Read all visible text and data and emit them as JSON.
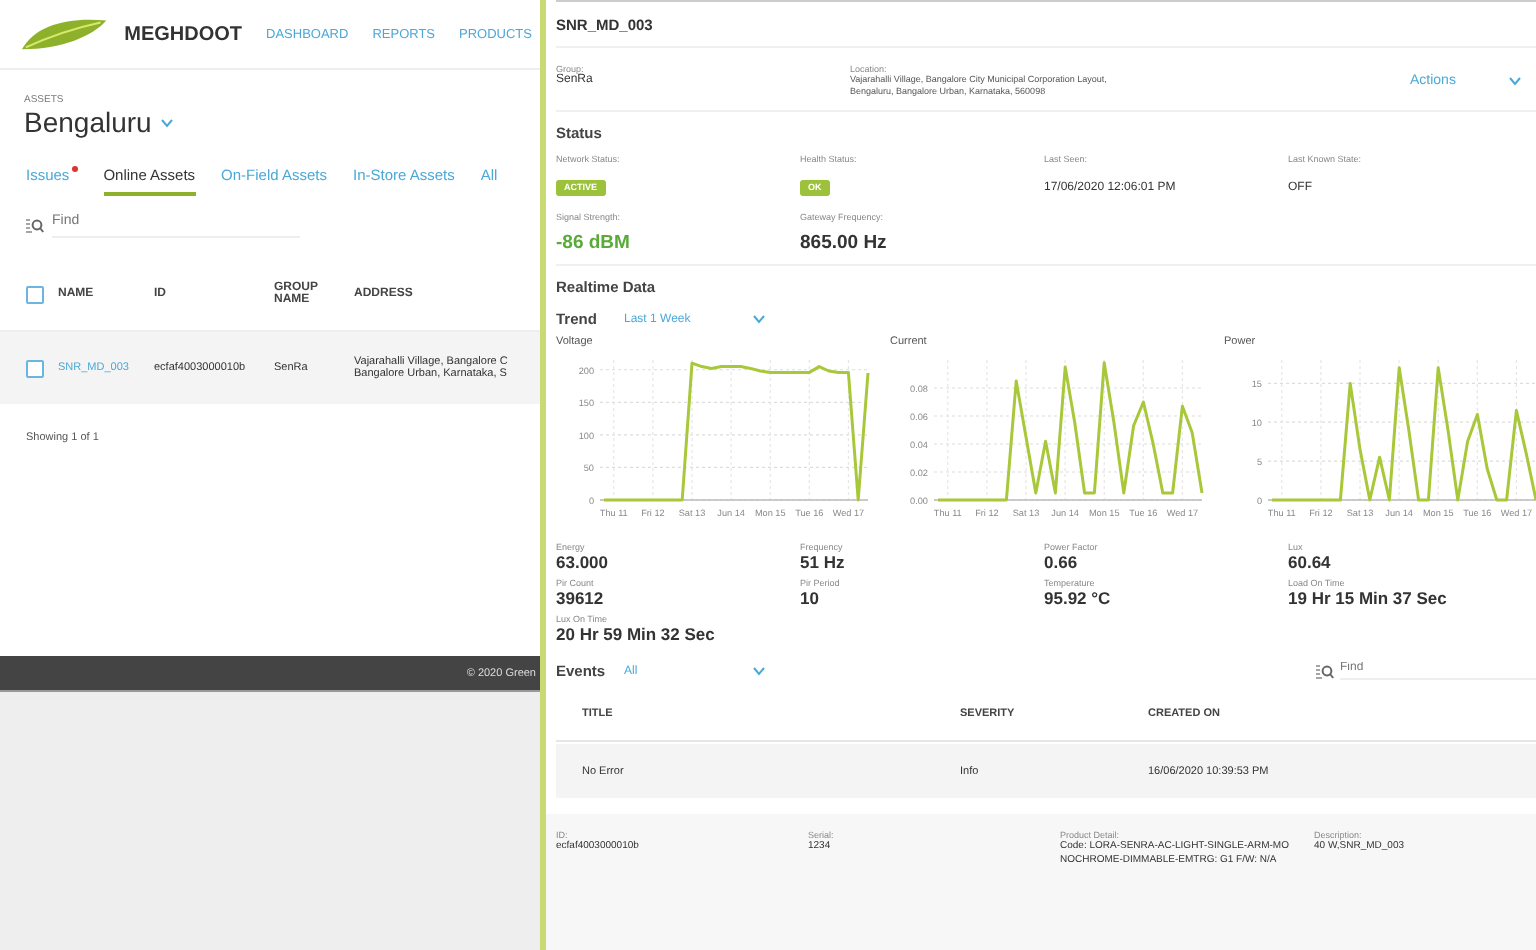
{
  "header": {
    "brand": "MEGHDOOT",
    "nav": [
      "DASHBOARD",
      "REPORTS",
      "PRODUCTS"
    ]
  },
  "assets": {
    "label": "ASSETS",
    "city": "Bengaluru"
  },
  "tabs": [
    {
      "label": "Issues",
      "selected": false,
      "alert": true
    },
    {
      "label": "Online Assets",
      "selected": true,
      "alert": false
    },
    {
      "label": "On-Field Assets",
      "selected": false,
      "alert": false
    },
    {
      "label": "In-Store Assets",
      "selected": false,
      "alert": false
    },
    {
      "label": "All",
      "selected": false,
      "alert": false
    }
  ],
  "search": {
    "placeholder": "Find"
  },
  "table": {
    "all_checked": false,
    "columns": [
      "NAME",
      "ID",
      "GROUP NAME",
      "ADDRESS"
    ],
    "rows": [
      {
        "checked": false,
        "name": "SNR_MD_003",
        "id": "ecfaf4003000010b",
        "group": "SenRa",
        "address": [
          "Vajarahalli Village, Bangalore C",
          "Bangalore Urban, Karnataka, S"
        ]
      }
    ]
  },
  "showing": "Showing 1 of 1",
  "footer": "© 2020 Green",
  "panel": {
    "title": "SNR_MD_003",
    "group_label": "Group:",
    "group": "SenRa",
    "location_label": "Location:",
    "location": [
      "Vajarahalli Village, Bangalore City Municipal Corporation Layout,",
      "Bengaluru, Bangalore Urban, Karnataka, 560098"
    ],
    "actions": "Actions"
  },
  "status": {
    "heading": "Status",
    "fields": [
      {
        "label": "Network Status:",
        "value": "ACTIVE",
        "kind": "badge"
      },
      {
        "label": "Health Status:",
        "value": "OK",
        "kind": "badge"
      },
      {
        "label": "Last Seen:",
        "value": "17/06/2020 12:06:01 PM",
        "kind": "text"
      },
      {
        "label": "Last Known State:",
        "value": "OFF",
        "kind": "text"
      },
      {
        "label": "Signal Strength:",
        "value": "-86 dBM",
        "kind": "good"
      },
      {
        "label": "Gateway Frequency:",
        "value": "865.00 Hz",
        "kind": "big"
      }
    ]
  },
  "realtime": {
    "heading": "Realtime Data",
    "trend_label": "Trend",
    "trend_value": "Last 1 Week",
    "charts": [
      {
        "chart_data": {
          "type": "line",
          "title": "Voltage",
          "grid": true,
          "ylim": [
            0,
            215
          ],
          "yticks": [
            0,
            50,
            100,
            150,
            200
          ],
          "categories": [
            null,
            "Thu 11",
            null,
            null,
            null,
            "Fri 12",
            null,
            null,
            null,
            "Sat 13",
            null,
            null,
            null,
            "Jun 14",
            null,
            null,
            null,
            "Mon 15",
            null,
            null,
            null,
            "Tue 16",
            null,
            null,
            null,
            "Wed 17",
            null,
            null
          ],
          "series": [
            {
              "color": "#a8c83a",
              "values": [
                0,
                0,
                0,
                0,
                0,
                0,
                0,
                0,
                0,
                210,
                205,
                202,
                205,
                205,
                205,
                202,
                198,
                196,
                196,
                196,
                196,
                196,
                205,
                198,
                196,
                196,
                0,
                195
              ]
            }
          ]
        }
      },
      {
        "chart_data": {
          "type": "line",
          "title": "Current",
          "grid": true,
          "ylim": [
            0,
            0.1
          ],
          "yticks": [
            {
              "value": 0,
              "label": "0.00"
            },
            {
              "value": 0.02,
              "label": "0.02"
            },
            {
              "value": 0.04,
              "label": "0.04"
            },
            {
              "value": 0.06,
              "label": "0.06"
            },
            {
              "value": 0.08,
              "label": "0.08"
            }
          ],
          "categories": [
            null,
            "Thu 11",
            null,
            null,
            null,
            "Fri 12",
            null,
            null,
            null,
            "Sat 13",
            null,
            null,
            null,
            "Jun 14",
            null,
            null,
            null,
            "Mon 15",
            null,
            null,
            null,
            "Tue 16",
            null,
            null,
            null,
            "Wed 17",
            null,
            null
          ],
          "series": [
            {
              "color": "#a8c83a",
              "values": [
                0,
                0,
                0,
                0,
                0,
                0,
                0,
                0,
                0.085,
                0.045,
                0.005,
                0.042,
                0.005,
                0.095,
                0.055,
                0.005,
                0.005,
                0.098,
                0.055,
                0.005,
                0.053,
                0.07,
                0.04,
                0.005,
                0.005,
                0.067,
                0.048,
                0.005
              ]
            }
          ]
        }
      },
      {
        "chart_data": {
          "type": "line",
          "title": "Power",
          "grid": true,
          "ylim": [
            0,
            18
          ],
          "yticks": [
            0,
            5,
            10,
            15
          ],
          "categories": [
            null,
            "Thu 11",
            null,
            null,
            null,
            "Fri 12",
            null,
            null,
            null,
            "Sat 13",
            null,
            null,
            null,
            "Jun 14",
            null,
            null,
            null,
            "Mon 15",
            null,
            null,
            null,
            "Tue 16",
            null,
            null,
            null,
            "Wed 17",
            null,
            null
          ],
          "series": [
            {
              "color": "#a8c83a",
              "values": [
                0,
                0,
                0,
                0,
                0,
                0,
                0,
                0,
                15,
                6.5,
                0,
                5.5,
                0,
                17,
                9,
                0,
                0,
                17,
                9,
                0,
                7.5,
                11,
                4,
                0,
                0,
                11.5,
                6,
                0
              ]
            }
          ]
        }
      }
    ],
    "metrics": [
      {
        "label": "Energy",
        "value": "63.000"
      },
      {
        "label": "Frequency",
        "value": "51 Hz"
      },
      {
        "label": "Power Factor",
        "value": "0.66"
      },
      {
        "label": "Lux",
        "value": "60.64"
      },
      {
        "label": "Pir Count",
        "value": "39612"
      },
      {
        "label": "Pir Period",
        "value": "10"
      },
      {
        "label": "Temperature",
        "value": "95.92 °C"
      },
      {
        "label": "Load On Time",
        "value": "19 Hr 15 Min 37 Sec"
      },
      {
        "label": "Lux On Time",
        "value": "20 Hr 59 Min 32 Sec"
      }
    ]
  },
  "events": {
    "heading": "Events",
    "filter": "All",
    "search_placeholder": "Find",
    "columns": [
      "TITLE",
      "SEVERITY",
      "CREATED ON"
    ],
    "rows": [
      {
        "title": "No Error",
        "severity": "Info",
        "created_on": "16/06/2020 10:39:53 PM"
      }
    ]
  },
  "details": [
    {
      "label": "ID:",
      "value": "ecfaf4003000010b"
    },
    {
      "label": "Serial:",
      "value": "1234"
    },
    {
      "label": "Product Detail:",
      "value": "Code: LORA-SENRA-AC-LIGHT-SINGLE-ARM-MONOCHROME-DIMMABLE-EMTRG: G1 F/W: N/A"
    },
    {
      "label": "Description:",
      "value": "40 W,SNR_MD_003"
    }
  ]
}
